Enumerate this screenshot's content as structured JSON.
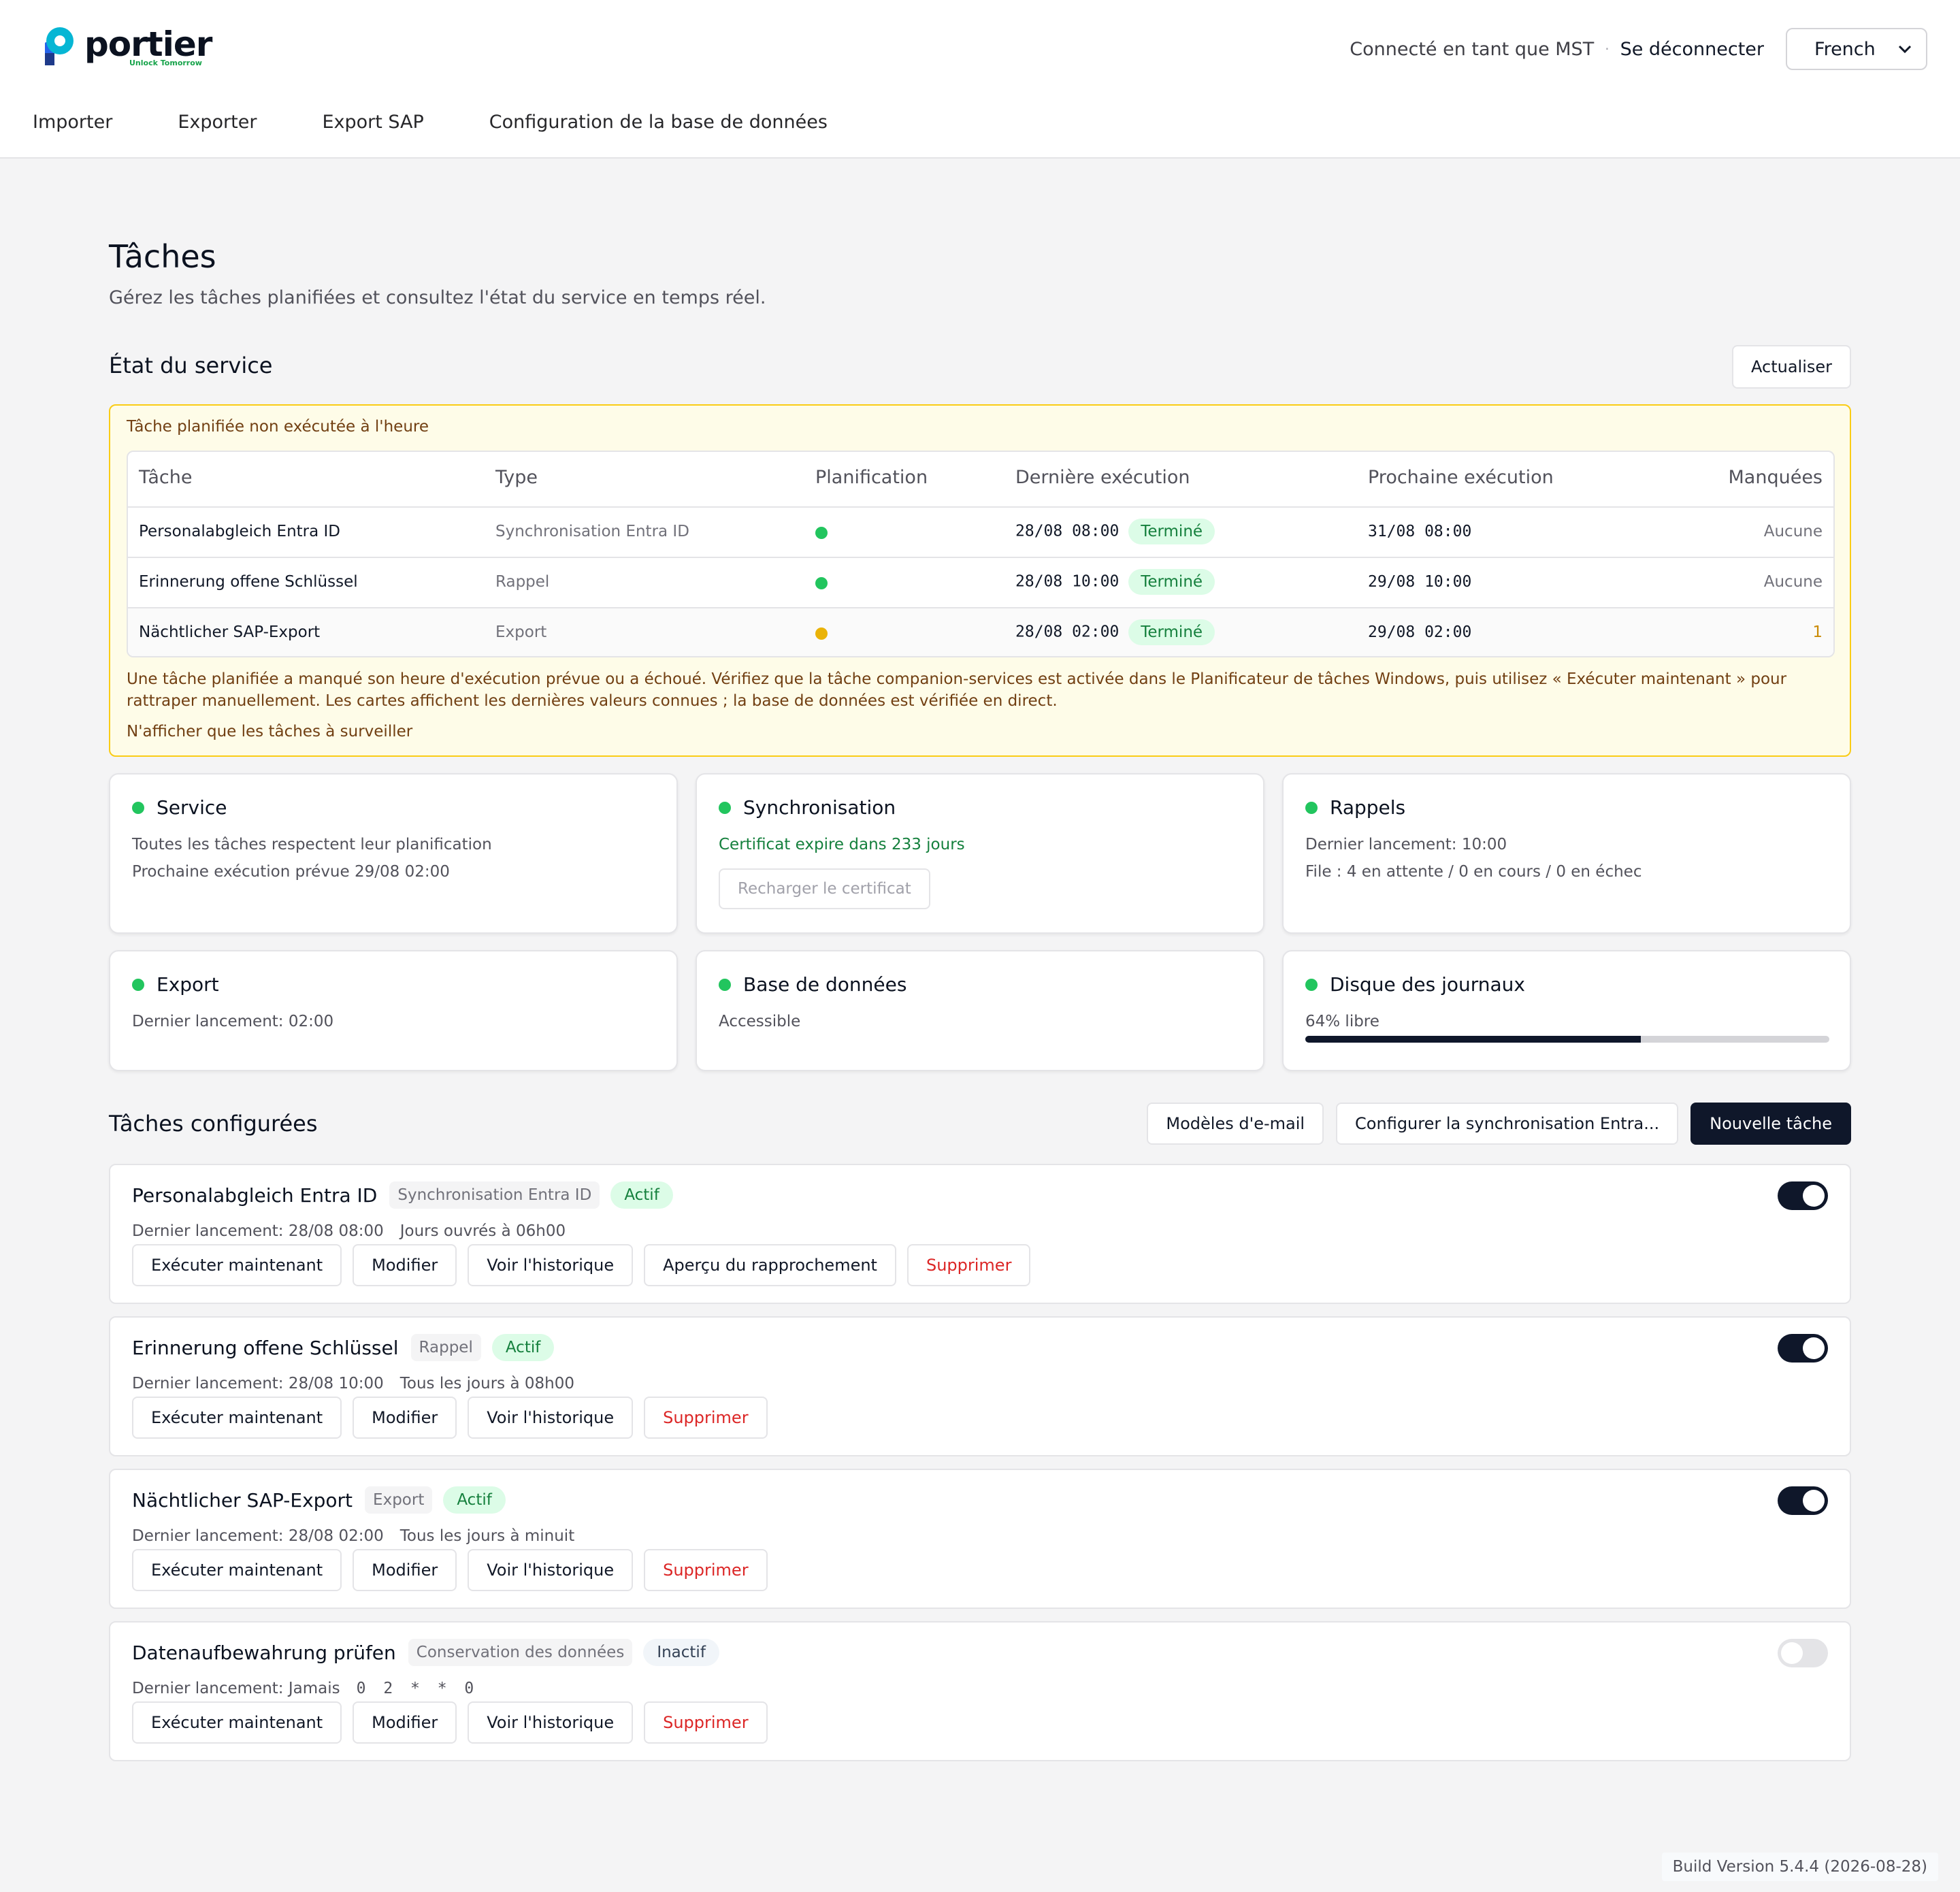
{
  "header": {
    "logo_text": "portier",
    "logo_tagline": "Unlock Tomorrow",
    "logged_in": "Connecté en tant que MST",
    "separator": "·",
    "logout": "Se déconnecter",
    "language": "French"
  },
  "nav": [
    "Importer",
    "Exporter",
    "Export SAP",
    "Configuration de la base de données"
  ],
  "page": {
    "title": "Tâches",
    "subtitle": "Gérez les tâches planifiées et consultez l'état du service en temps réel."
  },
  "service": {
    "title": "État du service",
    "refresh": "Actualiser"
  },
  "alert": {
    "heading": "Tâche planifiée non exécutée à l'heure",
    "columns": [
      "Tâche",
      "Type",
      "Planification",
      "Dernière exécution",
      "Prochaine exécution",
      "Manquées"
    ],
    "rows": [
      {
        "task": "Personalabgleich Entra ID",
        "type": "Synchronisation Entra ID",
        "schedule_status": "ok",
        "last": "28/08 08:00",
        "last_status": "Terminé",
        "next": "31/08 08:00",
        "missed": "Aucune"
      },
      {
        "task": "Erinnerung offene Schlüssel",
        "type": "Rappel",
        "schedule_status": "ok",
        "last": "28/08 10:00",
        "last_status": "Terminé",
        "next": "29/08 10:00",
        "missed": "Aucune"
      },
      {
        "task": "Nächtlicher SAP-Export",
        "type": "Export",
        "schedule_status": "warning",
        "last": "28/08 02:00",
        "last_status": "Terminé",
        "next": "29/08 02:00",
        "missed": "1"
      }
    ],
    "description": "Une tâche planifiée a manqué son heure d'exécution prévue ou a échoué. Vérifiez que la tâche companion-services est activée dans le Planificateur de tâches Windows, puis utilisez « Exécuter maintenant » pour rattraper manuellement. Les cartes affichent les dernières valeurs connues ; la base de données est vérifiée en direct.",
    "filter_link": "N'afficher que les tâches à surveiller"
  },
  "cards": {
    "service": {
      "title": "Service",
      "line1": "Toutes les tâches respectent leur planification",
      "line2": "Prochaine exécution prévue 29/08 02:00"
    },
    "sync": {
      "title": "Synchronisation",
      "line1": "Certificat expire dans 233 jours",
      "button": "Recharger le certificat"
    },
    "reminders": {
      "title": "Rappels",
      "line1": "Dernier lancement: 10:00",
      "line2": "File : 4 en attente / 0 en cours / 0 en échec"
    },
    "export": {
      "title": "Export",
      "line1": "Dernier lancement: 02:00"
    },
    "database": {
      "title": "Base de données",
      "line1": "Accessible"
    },
    "logdisk": {
      "title": "Disque des journaux",
      "line1": "64% libre",
      "free_fraction": 0.64
    }
  },
  "configured": {
    "title": "Tâches configurées",
    "email_templates": "Modèles d'e-mail",
    "configure_sync": "Configurer la synchronisation Entra...",
    "new_task": "Nouvelle tâche"
  },
  "actions": {
    "run": "Exécuter maintenant",
    "edit": "Modifier",
    "history": "Voir l'historique",
    "preview": "Aperçu du rapprochement",
    "delete": "Supprimer"
  },
  "tasks": [
    {
      "name": "Personalabgleich Entra ID",
      "type": "Synchronisation Entra ID",
      "status": "Actif",
      "last_run": "Dernier lancement: 28/08 08:00",
      "schedule": "Jours ouvrés à 06h00",
      "enabled": true
    },
    {
      "name": "Erinnerung offene Schlüssel",
      "type": "Rappel",
      "status": "Actif",
      "last_run": "Dernier lancement: 28/08 10:00",
      "schedule": "Tous les jours à 08h00",
      "enabled": true
    },
    {
      "name": "Nächtlicher SAP-Export",
      "type": "Export",
      "status": "Actif",
      "last_run": "Dernier lancement: 28/08 02:00",
      "schedule": "Tous les jours à minuit",
      "enabled": true
    },
    {
      "name": "Datenaufbewahrung prüfen",
      "type": "Conservation des données",
      "status": "Inactif",
      "last_run": "Dernier lancement: Jamais",
      "schedule": "0 2 * * 0",
      "enabled": false
    }
  ],
  "footer": {
    "build": "Build Version 5.4.4 (2026-08-28)"
  },
  "colors": {
    "accent_dark": "#0f172a",
    "success": "#22c55e",
    "warning": "#eab308",
    "danger": "#dc2626",
    "alert_bg": "#fefce8",
    "alert_border": "#facc15"
  }
}
